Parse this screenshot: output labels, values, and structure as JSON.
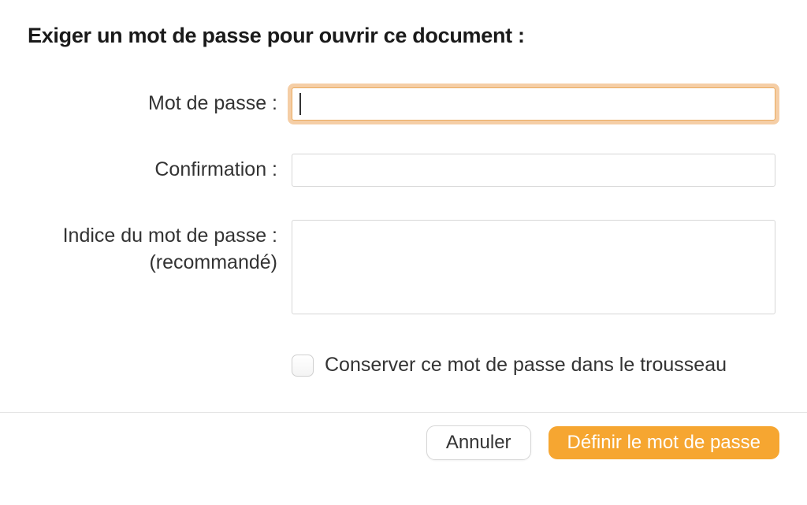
{
  "dialog": {
    "title": "Exiger un mot de passe pour ouvrir ce document :",
    "fields": {
      "password": {
        "label": "Mot de passe :",
        "value": ""
      },
      "confirm": {
        "label": "Confirmation :",
        "value": ""
      },
      "hint": {
        "label_line1": "Indice du mot de passe :",
        "label_line2": "(recommandé)",
        "value": ""
      }
    },
    "checkbox": {
      "label": "Conserver ce mot de passe dans le trousseau",
      "checked": false
    },
    "buttons": {
      "cancel": "Annuler",
      "set_password": "Définir le mot de passe"
    }
  }
}
